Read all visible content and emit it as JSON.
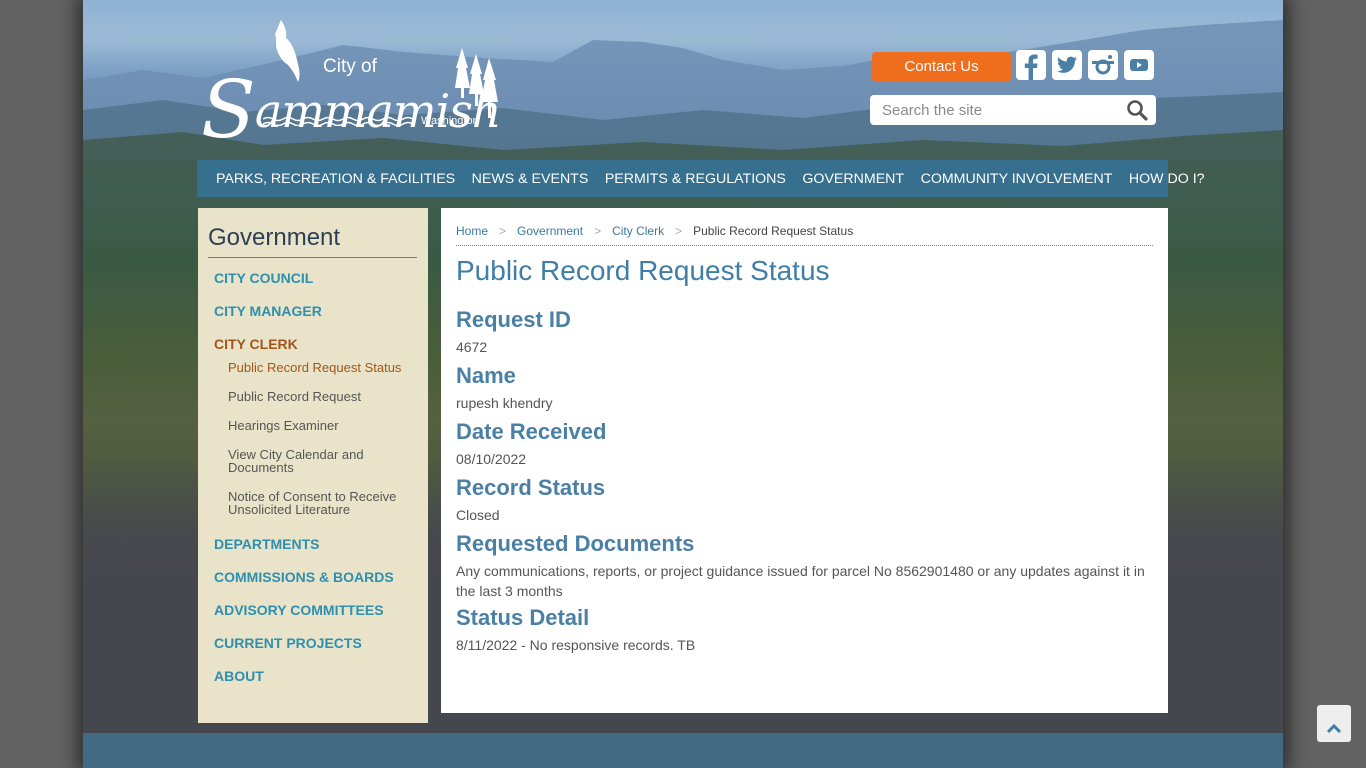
{
  "header": {
    "logo": {
      "city_of": "City of",
      "name_initial": "S",
      "name_rest": "ammamish",
      "state": "Washington"
    },
    "contact_label": "Contact Us",
    "social": [
      {
        "name": "facebook",
        "icon": "facebook-icon"
      },
      {
        "name": "twitter",
        "icon": "twitter-icon"
      },
      {
        "name": "instagram",
        "icon": "instagram-icon"
      },
      {
        "name": "youtube",
        "icon": "youtube-icon"
      }
    ],
    "search": {
      "placeholder": "Search the site",
      "value": "",
      "icon": "search-icon"
    }
  },
  "nav": {
    "items": [
      "PARKS, RECREATION & FACILITIES",
      "NEWS & EVENTS",
      "PERMITS & REGULATIONS",
      "GOVERNMENT",
      "COMMUNITY INVOLVEMENT",
      "HOW DO I?"
    ]
  },
  "sidebar": {
    "title": "Government",
    "items": [
      {
        "label": "CITY COUNCIL"
      },
      {
        "label": "CITY MANAGER"
      },
      {
        "label": "CITY CLERK",
        "active": true
      },
      {
        "label": "DEPARTMENTS"
      },
      {
        "label": "COMMISSIONS & BOARDS"
      },
      {
        "label": "ADVISORY COMMITTEES"
      },
      {
        "label": "CURRENT PROJECTS"
      },
      {
        "label": "ABOUT"
      }
    ],
    "sub_items": [
      {
        "label": "Public Record Request Status",
        "active": true
      },
      {
        "label": "Public Record Request"
      },
      {
        "label": "Hearings Examiner"
      },
      {
        "label": "View City Calendar and Documents"
      },
      {
        "label": "Notice of Consent to Receive Unsolicited Literature"
      }
    ]
  },
  "breadcrumb": [
    "Home",
    "Government",
    "City Clerk",
    "Public Record Request Status"
  ],
  "main": {
    "title": "Public Record Request Status",
    "fields": [
      {
        "label": "Request ID",
        "value": "4672"
      },
      {
        "label": "Name",
        "value": "rupesh khendry"
      },
      {
        "label": "Date Received",
        "value": "08/10/2022"
      },
      {
        "label": "Record Status",
        "value": "Closed"
      },
      {
        "label": "Requested Documents",
        "value": "Any communications, reports, or project guidance issued for parcel No 8562901480 or any updates against it in the last 3 months"
      },
      {
        "label": "Status Detail",
        "value": "8/11/2022 - No responsive records. TB"
      }
    ]
  },
  "colors": {
    "accent_orange": "#ee6e1e",
    "nav_blue": "#376f8f",
    "sidebar_bg": "#e9e4c9",
    "link_teal": "#2e8fae",
    "active_brown": "#a0561b",
    "heading_blue": "#3f7ea6"
  },
  "back_to_top": {
    "icon": "chevron-up-icon"
  }
}
